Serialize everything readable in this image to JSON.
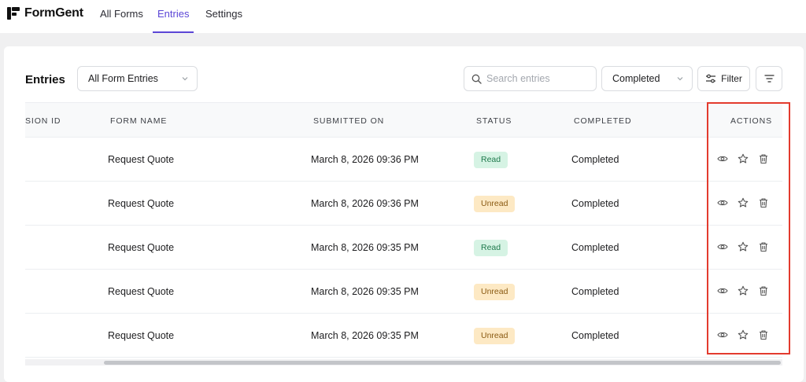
{
  "app": {
    "name": "FormGent"
  },
  "nav": {
    "tabs": [
      {
        "label": "All Forms",
        "active": false
      },
      {
        "label": "Entries",
        "active": true
      },
      {
        "label": "Settings",
        "active": false
      }
    ]
  },
  "toolbar": {
    "title": "Entries",
    "form_select": "All Form Entries",
    "search_placeholder": "Search entries",
    "status_select": "Completed",
    "filter_label": "Filter"
  },
  "table": {
    "columns": [
      "SION ID",
      "FORM NAME",
      "SUBMITTED ON",
      "STATUS",
      "COMPLETED",
      "ACTIONS"
    ],
    "rows": [
      {
        "form": "Request Quote",
        "submitted": "March 8, 2026 09:36 PM",
        "status": "Read",
        "completed": "Completed"
      },
      {
        "form": "Request Quote",
        "submitted": "March 8, 2026 09:36 PM",
        "status": "Unread",
        "completed": "Completed"
      },
      {
        "form": "Request Quote",
        "submitted": "March 8, 2026 09:35 PM",
        "status": "Read",
        "completed": "Completed"
      },
      {
        "form": "Request Quote",
        "submitted": "March 8, 2026 09:35 PM",
        "status": "Unread",
        "completed": "Completed"
      },
      {
        "form": "Request Quote",
        "submitted": "March 8, 2026 09:35 PM",
        "status": "Unread",
        "completed": "Completed"
      }
    ],
    "row_actions": [
      "eye-icon",
      "star-icon",
      "trash-icon"
    ]
  },
  "colors": {
    "accent": "#5b46d6",
    "read_badge_bg": "#d6f3e4",
    "unread_badge_bg": "#fde9c4",
    "highlight": "#e33b2e"
  }
}
